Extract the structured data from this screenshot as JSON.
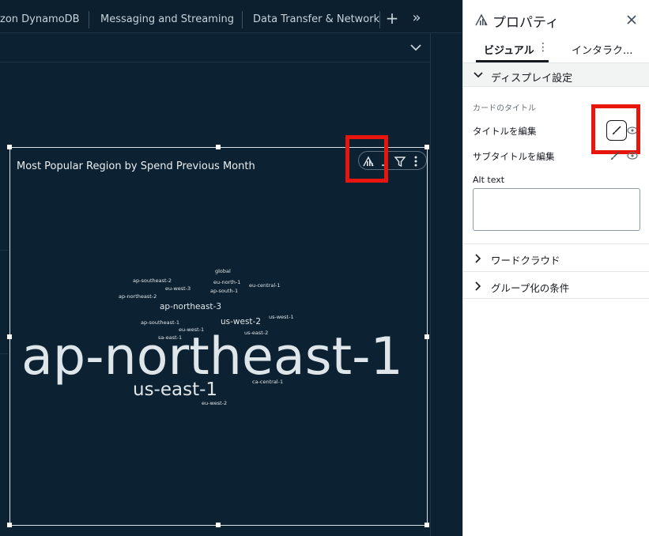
{
  "tabs": [
    {
      "label": "zon DynamoDB"
    },
    {
      "label": "Messaging and Streaming"
    },
    {
      "label": "Data Transfer & Networking"
    }
  ],
  "visual": {
    "title": "Most Popular Region by Spend Previous Month"
  },
  "wordcloud": {
    "words": [
      {
        "text": "ap-northeast-1",
        "weight": 100
      },
      {
        "text": "us-east-1",
        "weight": 32
      },
      {
        "text": "ap-northeast-3",
        "weight": 14
      },
      {
        "text": "us-west-2",
        "weight": 13
      },
      {
        "text": "global",
        "weight": 7
      },
      {
        "text": "ap-southeast-2",
        "weight": 7
      },
      {
        "text": "eu-north-1",
        "weight": 7
      },
      {
        "text": "eu-west-3",
        "weight": 7
      },
      {
        "text": "eu-central-1",
        "weight": 7
      },
      {
        "text": "ap-south-1",
        "weight": 7
      },
      {
        "text": "ap-northeast-2",
        "weight": 7
      },
      {
        "text": "us-west-1",
        "weight": 7
      },
      {
        "text": "ap-southeast-1",
        "weight": 7
      },
      {
        "text": "eu-west-1",
        "weight": 7
      },
      {
        "text": "us-east-2",
        "weight": 7
      },
      {
        "text": "sa-east-1",
        "weight": 7
      },
      {
        "text": "ca-central-1",
        "weight": 7
      },
      {
        "text": "eu-west-2",
        "weight": 7
      }
    ]
  },
  "panel": {
    "title": "プロパティ",
    "tab_visual": "ビジュアル",
    "tab_interaction": "インタラク...",
    "section_display": "ディスプレイ設定",
    "card_title_heading": "カードのタイトル",
    "edit_title": "タイトルを編集",
    "edit_subtitle": "サブタイトルを編集",
    "alt_text_label": "Alt text",
    "alt_text_value": "",
    "section_wordcloud": "ワードクラウド",
    "section_group_by": "グループ化の条件"
  },
  "colors": {
    "canvas_bg": "#0c2131",
    "highlight": "#e8150c",
    "panel_bg": "#ffffff"
  }
}
